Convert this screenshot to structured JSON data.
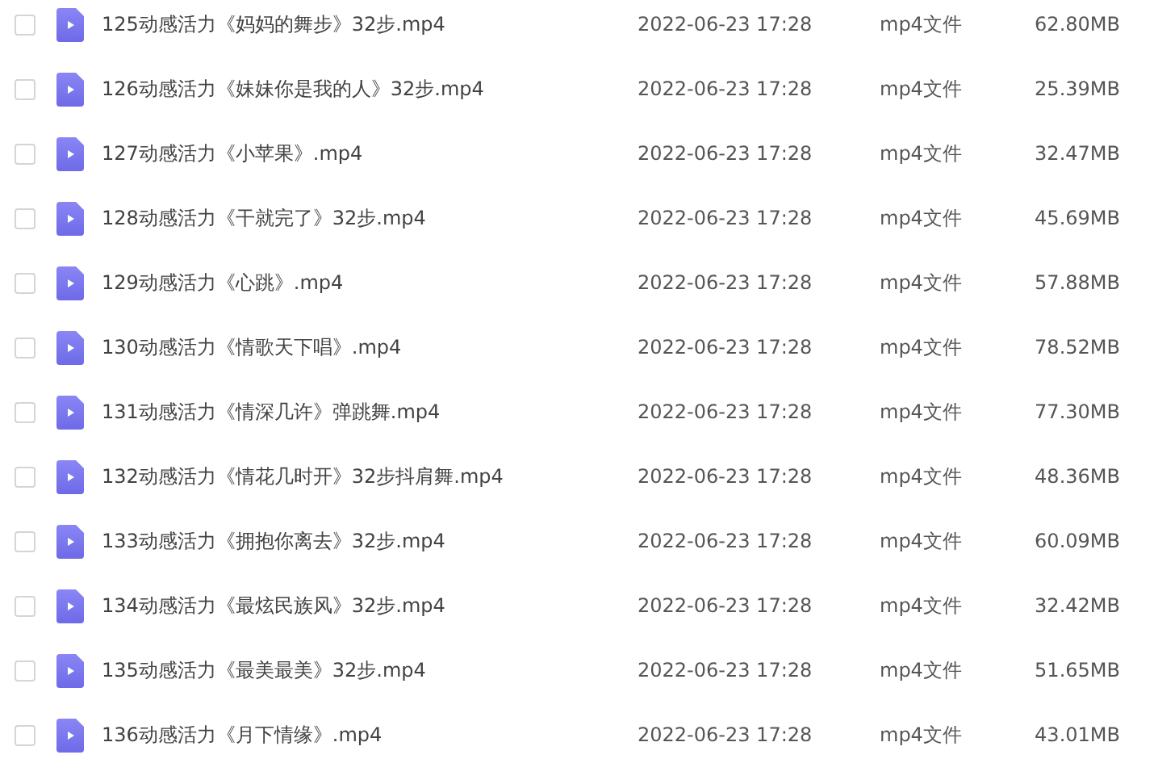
{
  "files": [
    {
      "name": "125动感活力《妈妈的舞步》32步.mp4",
      "modified": "2022-06-23 17:28",
      "type": "mp4文件",
      "size": "62.80MB",
      "checked": false
    },
    {
      "name": "126动感活力《妹妹你是我的人》32步.mp4",
      "modified": "2022-06-23 17:28",
      "type": "mp4文件",
      "size": "25.39MB",
      "checked": false
    },
    {
      "name": "127动感活力《小苹果》.mp4",
      "modified": "2022-06-23 17:28",
      "type": "mp4文件",
      "size": "32.47MB",
      "checked": false
    },
    {
      "name": "128动感活力《干就完了》32步.mp4",
      "modified": "2022-06-23 17:28",
      "type": "mp4文件",
      "size": "45.69MB",
      "checked": false
    },
    {
      "name": "129动感活力《心跳》.mp4",
      "modified": "2022-06-23 17:28",
      "type": "mp4文件",
      "size": "57.88MB",
      "checked": false
    },
    {
      "name": "130动感活力《情歌天下唱》.mp4",
      "modified": "2022-06-23 17:28",
      "type": "mp4文件",
      "size": "78.52MB",
      "checked": false
    },
    {
      "name": "131动感活力《情深几许》弹跳舞.mp4",
      "modified": "2022-06-23 17:28",
      "type": "mp4文件",
      "size": "77.30MB",
      "checked": false
    },
    {
      "name": "132动感活力《情花几时开》32步抖肩舞.mp4",
      "modified": "2022-06-23 17:28",
      "type": "mp4文件",
      "size": "48.36MB",
      "checked": false
    },
    {
      "name": "133动感活力《拥抱你离去》32步.mp4",
      "modified": "2022-06-23 17:28",
      "type": "mp4文件",
      "size": "60.09MB",
      "checked": false
    },
    {
      "name": "134动感活力《最炫民族风》32步.mp4",
      "modified": "2022-06-23 17:28",
      "type": "mp4文件",
      "size": "32.42MB",
      "checked": false
    },
    {
      "name": "135动感活力《最美最美》32步.mp4",
      "modified": "2022-06-23 17:28",
      "type": "mp4文件",
      "size": "51.65MB",
      "checked": false
    },
    {
      "name": "136动感活力《月下情缘》.mp4",
      "modified": "2022-06-23 17:28",
      "type": "mp4文件",
      "size": "43.01MB",
      "checked": false
    }
  ]
}
